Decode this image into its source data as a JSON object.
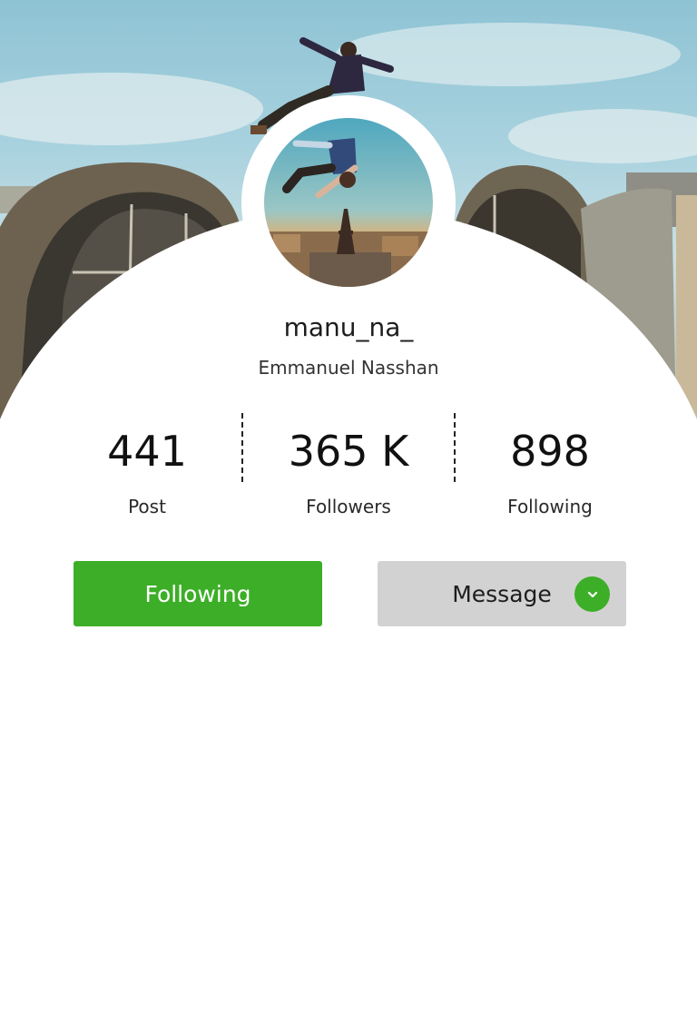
{
  "profile": {
    "username": "manu_na_",
    "full_name": "Emmanuel Nasshan"
  },
  "stats": [
    {
      "value": "441",
      "label": "Post"
    },
    {
      "value": "365 K",
      "label": "Followers"
    },
    {
      "value": "898",
      "label": "Following"
    }
  ],
  "actions": {
    "follow_label": "Following",
    "message_label": "Message"
  },
  "colors": {
    "accent": "#3cae27",
    "message_button": "#d2d2d2"
  },
  "icons": {
    "dropdown": "chevron-down-icon"
  }
}
